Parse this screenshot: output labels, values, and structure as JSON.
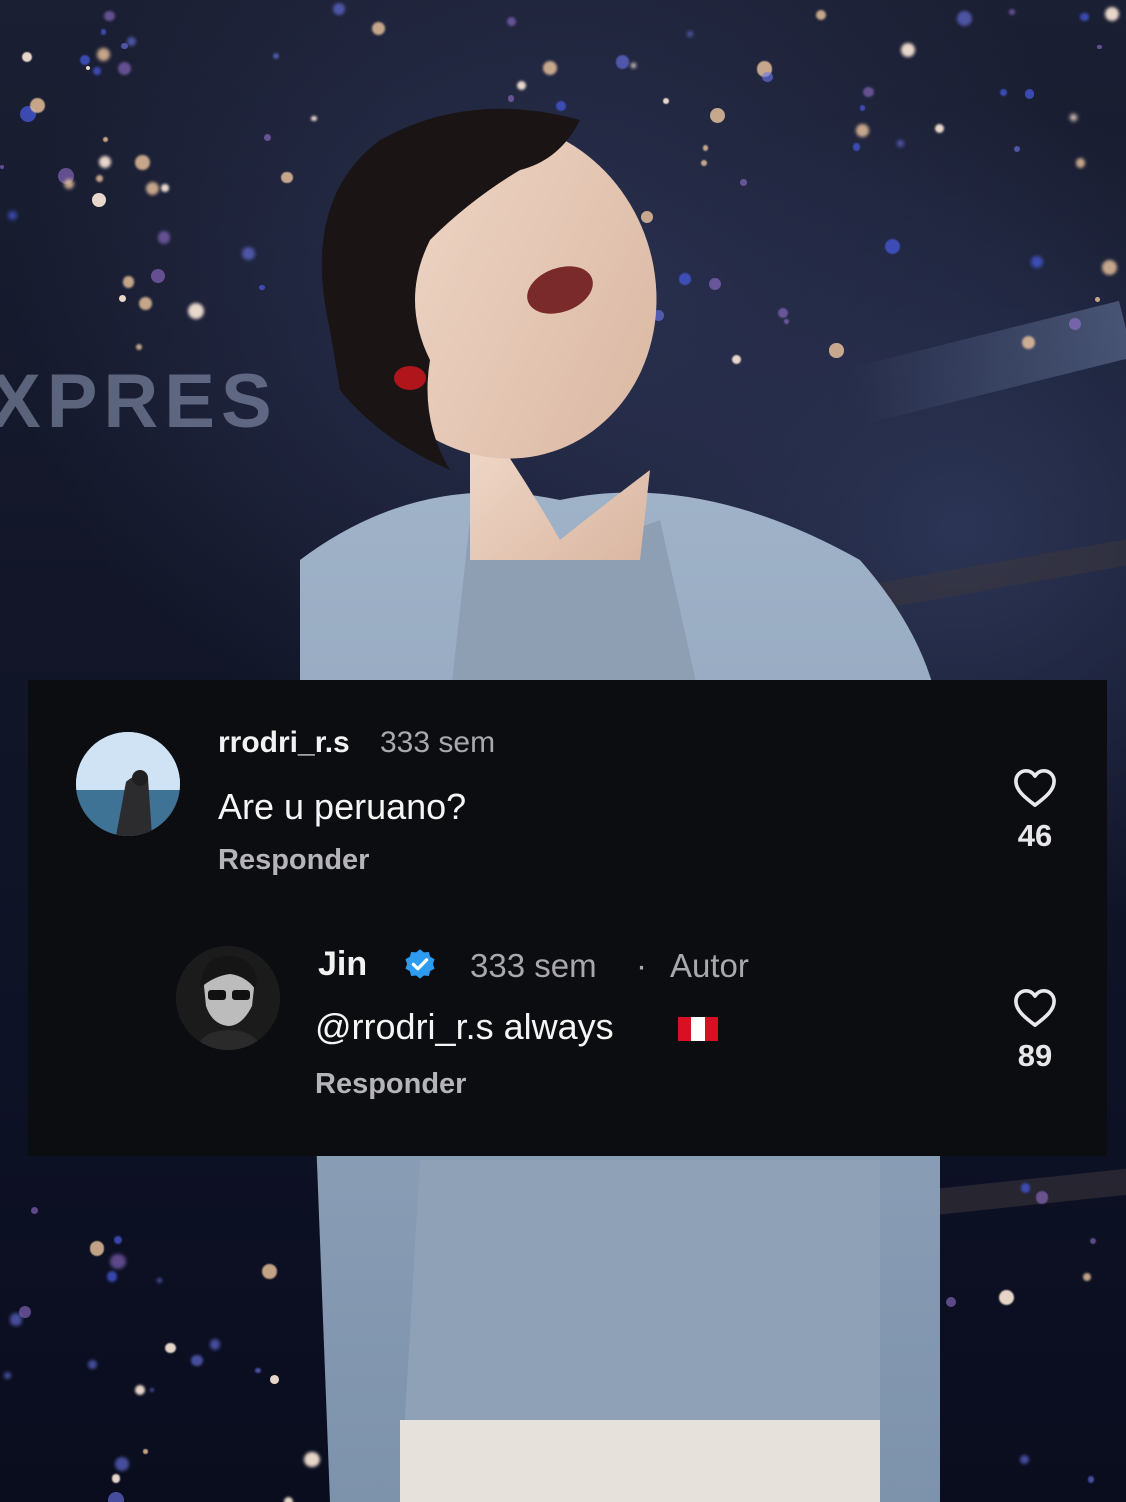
{
  "comments": [
    {
      "username": "rrodri_r.s",
      "time": "333 sem",
      "text": "Are u peruano?",
      "reply_label": "Responder",
      "likes": "46",
      "avatar_icon": "user-avatar-beach"
    },
    {
      "username": "Jin",
      "verified": true,
      "time": "333 sem",
      "separator": "·",
      "badge": "Autor",
      "text": "@rrodri_r.s always",
      "emoji": "peru-flag",
      "reply_label": "Responder",
      "likes": "89",
      "avatar_icon": "user-avatar-portrait"
    }
  ],
  "background": {
    "sign_text": "XPRES"
  },
  "colors": {
    "panel_bg": "#0c0d10",
    "verified_blue": "#2d9bf0",
    "flag_red": "#d91023",
    "flag_white": "#ffffff"
  }
}
